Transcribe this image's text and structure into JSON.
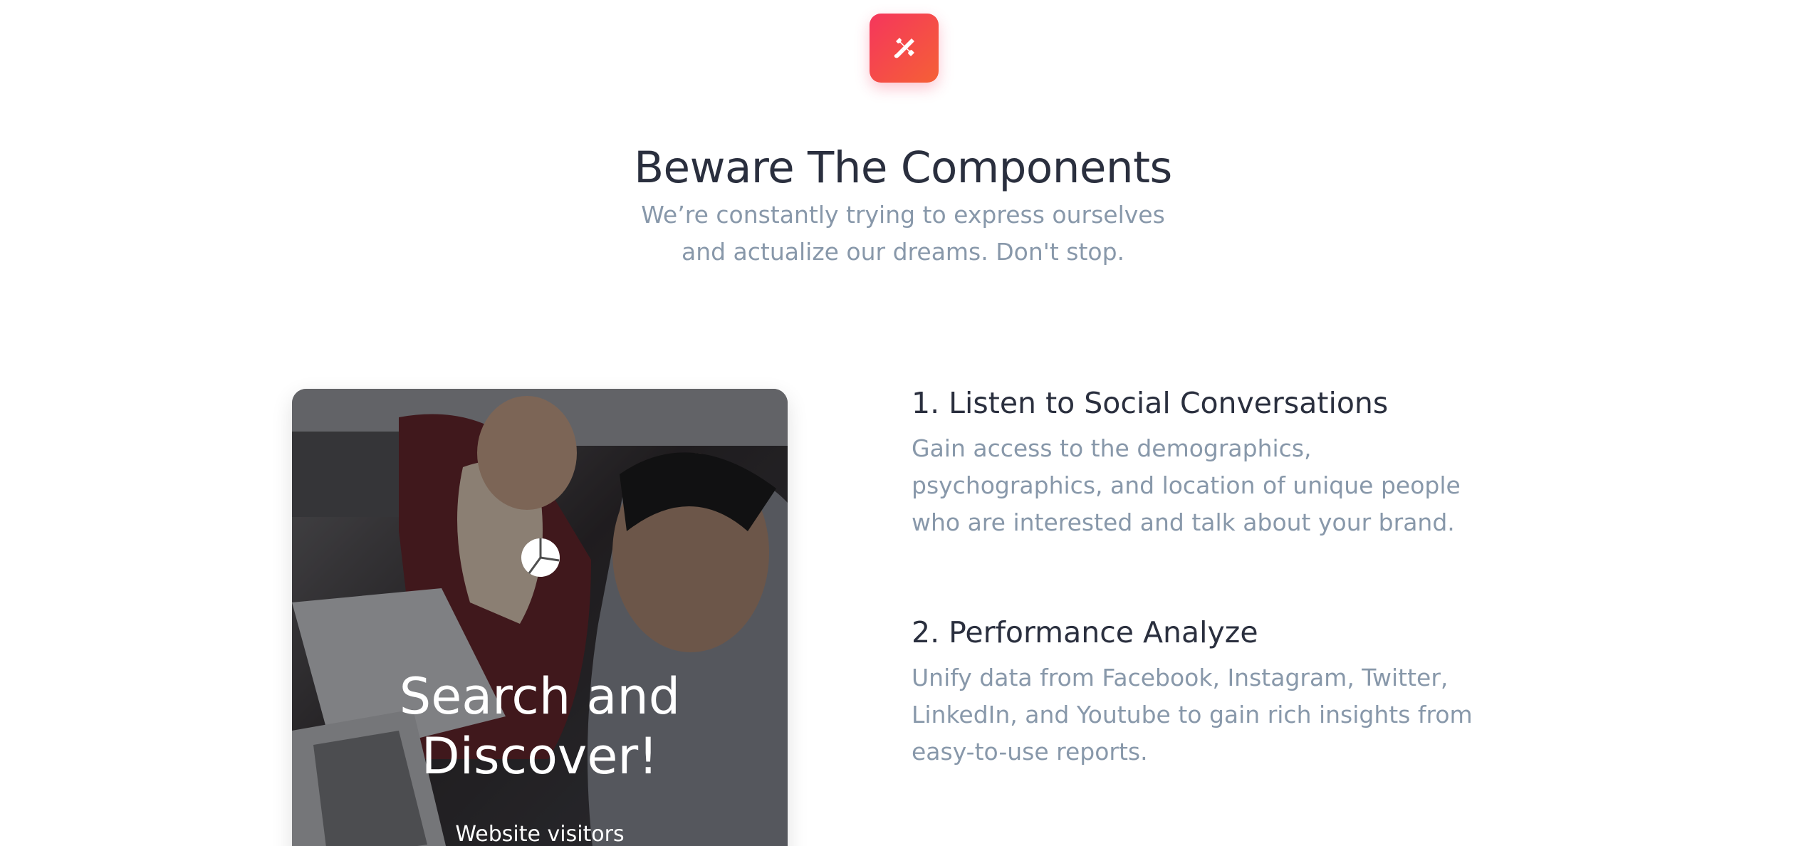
{
  "header": {
    "icon": "tools-icon",
    "accent_gradient": [
      "#f5365c",
      "#f56036"
    ],
    "title": "Beware The Components",
    "subtitle": "We’re constantly trying to express ourselves and actualize our dreams. Don't stop."
  },
  "card": {
    "icon": "pie-chart-icon",
    "title": "Search and Discover!",
    "caption": "Website visitors"
  },
  "features": [
    {
      "title": "1. Listen to Social Conversations",
      "text": "Gain access to the demographics, psychographics, and location of unique people who are interested and talk about your brand."
    },
    {
      "title": "2. Performance Analyze",
      "text": "Unify data from Facebook, Instagram, Twitter, LinkedIn, and Youtube to gain rich insights from easy-to-use reports."
    }
  ],
  "colors": {
    "heading": "#2a2f3e",
    "muted": "#8898aa"
  }
}
